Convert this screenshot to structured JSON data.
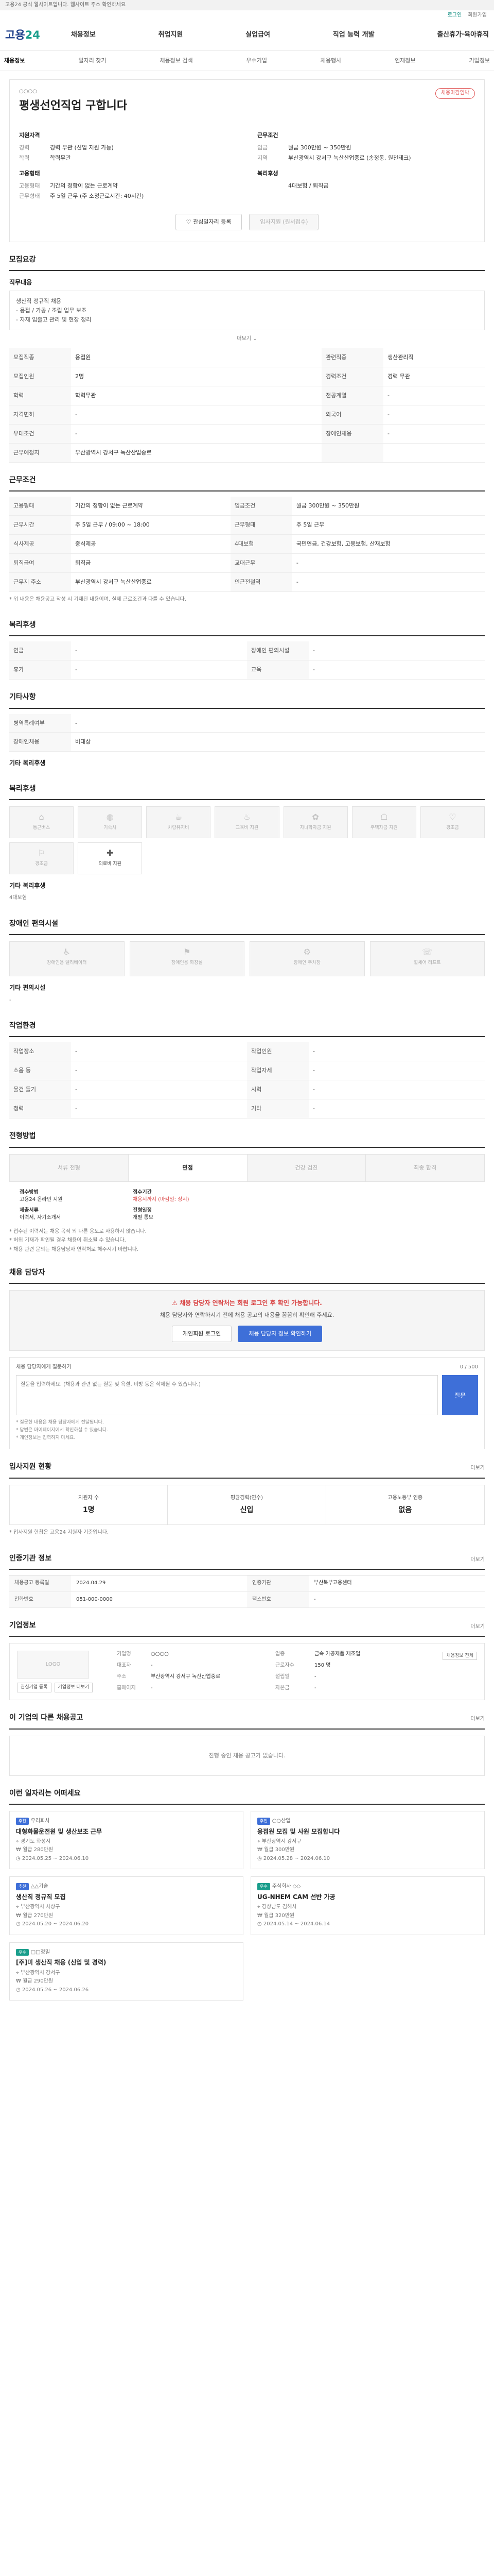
{
  "top_notice": "고용24 공식 웹사이트입니다. 웹사이트 주소 확인하세요",
  "util": {
    "login": "로그인",
    "signup": "회원가입"
  },
  "logo": {
    "part1": "고용",
    "part2": "24"
  },
  "gnb": [
    "채용정보",
    "취업지원",
    "실업급여",
    "직업 능력 개발",
    "출산휴가·육아휴직"
  ],
  "crumbs": [
    "채용정보",
    "일자리 찾기",
    "채용정보 검색",
    "우수기업",
    "채용행사",
    "인재정보",
    "기업정보"
  ],
  "job": {
    "company": "○○○○",
    "title": "평생선언직업 구합니다",
    "badge": "채용마감임박",
    "left_title": "지원자격",
    "left_rows": [
      {
        "k": "경력",
        "v": "경력 무관 (신입 지원 가능)"
      },
      {
        "k": "학력",
        "v": "학력무관"
      }
    ],
    "right_title": "근무조건",
    "right_rows": [
      {
        "k": "임금",
        "v": "월급 300만원 ~ 350만원"
      },
      {
        "k": "지역",
        "v": "부산광역시 강서구 녹산산업중로 (송정동, 원천테크)"
      }
    ],
    "left2_title": "고용형태",
    "left2_rows": [
      {
        "k": "고용형태",
        "v": "기간의 정함이 없는 근로계약"
      },
      {
        "k": "근무형태",
        "v": "주 5일 근무 (주 소정근로시간: 40시간)"
      }
    ],
    "right2_title": "복리후생",
    "right2_rows": [
      {
        "k": "",
        "v": "4대보험 / 퇴직금"
      }
    ],
    "btn_save": "관심일자리 등록",
    "btn_apply": "입사지원 (원서접수)"
  },
  "recruit": {
    "title": "모집요강",
    "sub": "직무내용",
    "box": [
      "생산직 정규직 채용",
      "- 용접 / 가공 / 조립 업무 보조",
      "- 자재 입출고 관리 및 현장 정리"
    ],
    "fold": "더보기",
    "rows": [
      [
        "모집직종",
        "용접원",
        "관련직종",
        "생산관리직"
      ],
      [
        "모집인원",
        "2명",
        "경력조건",
        "경력 무관"
      ],
      [
        "학력",
        "학력무관",
        "전공계열",
        "-"
      ],
      [
        "자격면허",
        "-",
        "외국어",
        "-"
      ],
      [
        "우대조건",
        "-",
        "장애인채용",
        "-"
      ],
      [
        "근무예정지",
        "부산광역시 강서구 녹산산업중로",
        "",
        ""
      ]
    ]
  },
  "condition": {
    "title": "근무조건",
    "rows": [
      [
        "고용형태",
        "기간의 정함이 없는 근로계약",
        "임금조건",
        "월급 300만원 ~ 350만원"
      ],
      [
        "근무시간",
        "주 5일 근무 / 09:00 ~ 18:00",
        "근무형태",
        "주 5일 근무"
      ],
      [
        "식사제공",
        "중식제공",
        "4대보험",
        "국민연금, 건강보험, 고용보험, 산재보험"
      ],
      [
        "퇴직급여",
        "퇴직금",
        "교대근무",
        "-"
      ],
      [
        "근무지 주소",
        "부산광역시 강서구 녹산산업중로",
        "인근전철역",
        "-"
      ]
    ],
    "note": "* 위 내용은 채용공고 작성 시 기재된 내용이며, 실제 근로조건과 다를 수 있습니다."
  },
  "welfare": {
    "title": "복리후생",
    "rows": [
      [
        "연금",
        "-",
        "장애인 편의시설",
        "-"
      ],
      [
        "휴가",
        "-",
        "교육",
        "-"
      ]
    ]
  },
  "etc": {
    "title": "기타사항",
    "rows": [
      [
        "병역특례여부",
        "-"
      ],
      [
        "장애인채용",
        "비대상"
      ]
    ],
    "sub": "기타 복리후생"
  },
  "welfare_icons": {
    "title": "복리후생",
    "items": [
      {
        "icon": "⌂",
        "label": "통근버스",
        "on": false
      },
      {
        "icon": "◍",
        "label": "기숙사",
        "on": false
      },
      {
        "icon": "☕",
        "label": "차량유지비",
        "on": false
      },
      {
        "icon": "♨",
        "label": "교육비 지원",
        "on": false
      },
      {
        "icon": "✿",
        "label": "자녀학자금 지원",
        "on": false
      },
      {
        "icon": "☖",
        "label": "주택자금 지원",
        "on": false
      },
      {
        "icon": "♡",
        "label": "경조금",
        "on": false
      },
      {
        "icon": "⚐",
        "label": "경조금",
        "on": false
      },
      {
        "icon": "✚",
        "label": "의료비 지원",
        "on": true
      }
    ],
    "etc_label": "기타 복리후생",
    "etc_value": "4대보험"
  },
  "disabled": {
    "title": "장애인 편의시설",
    "items": [
      {
        "icon": "♿",
        "label": "장애인용 엘리베이터"
      },
      {
        "icon": "⚑",
        "label": "장애인용 화장실"
      },
      {
        "icon": "⚙",
        "label": "장애인 주차장"
      },
      {
        "icon": "☏",
        "label": "휠체어 리프트"
      }
    ],
    "sub": "기타 편의시설",
    "value": "-"
  },
  "env": {
    "title": "작업환경",
    "rows": [
      [
        "작업장소",
        "-",
        "작업인원",
        "-"
      ],
      [
        "소음 등",
        "-",
        "작업자세",
        "-"
      ],
      [
        "물건 들기",
        "-",
        "시력",
        "-"
      ],
      [
        "청력",
        "-",
        "기타",
        "-"
      ]
    ]
  },
  "process": {
    "title": "전형방법",
    "steps": [
      "서류 전형",
      "면접",
      "건강 검진",
      "최종 합격"
    ],
    "active": 1,
    "info": [
      {
        "k": "접수방법",
        "v": "고용24 온라인 지원",
        "red": false
      },
      {
        "k": "접수기간",
        "v": "채용시까지 (마감일: 상시)",
        "red": true
      },
      {
        "k": "제출서류",
        "v": "이력서, 자기소개서",
        "red": false
      },
      {
        "k": "전형일정",
        "v": "개별 통보",
        "red": false
      }
    ],
    "notes": [
      "* 접수된 이력서는 채용 목적 외 다른 용도로 사용하지 않습니다.",
      "* 허위 기재가 확인될 경우 채용이 취소될 수 있습니다.",
      "* 채용 관련 문의는 채용담당자 연락처로 해주시기 바랍니다."
    ]
  },
  "contact": {
    "title": "채용 담당자",
    "warn": "채용 담당자 연락처는 회원 로그인 후 확인 가능합니다.",
    "desc": "채용 담당자와 연락하시기 전에 채용 공고의 내용을 꼼꼼히 확인해 주세요.",
    "btn1": "개인회원 로그인",
    "btn2": "채용 담당자 정보 확인하기"
  },
  "inquiry": {
    "title": "채용 담당자에게 질문하기",
    "count": "0 / 500",
    "placeholder": "질문을 입력하세요. (채용과 관련 없는 질문 및 욕설, 비방 등은 삭제될 수 있습니다.)",
    "btn": "질문",
    "notes": [
      "* 질문한 내용은 채용 담당자에게 전달됩니다.",
      "* 답변은 마이페이지에서 확인하실 수 있습니다.",
      "* 개인정보는 입력하지 마세요."
    ]
  },
  "stats": {
    "title": "입사지원 현황",
    "more": "더보기",
    "items": [
      {
        "label": "지원자 수",
        "value": "1명"
      },
      {
        "label": "평균경력(연수)",
        "value": "신입"
      },
      {
        "label": "고용노동부 인증",
        "value": "없음"
      }
    ],
    "note": "* 입사지원 현황은 고용24 지원자 기준입니다."
  },
  "agency": {
    "title": "인증기관 정보",
    "more": "더보기",
    "rows": [
      [
        "채용공고 등록일",
        "2024.04.29",
        "인증기관",
        "부산북부고용센터"
      ],
      [
        "전화번호",
        "051-000-0000",
        "팩스번호",
        "-"
      ]
    ]
  },
  "corp": {
    "title": "기업정보",
    "more": "더보기",
    "logo": "LOGO",
    "btn1": "관심기업 등록",
    "btn2": "기업정보 더보기",
    "side": "채용정보 전체",
    "rows": [
      [
        "기업명",
        "○○○○",
        "업종",
        "금속 가공제품 제조업"
      ],
      [
        "대표자",
        "-",
        "근로자수",
        "150 명"
      ],
      [
        "주소",
        "부산광역시 강서구 녹산산업중로",
        "설립일",
        "-"
      ],
      [
        "홈페이지",
        "-",
        "자본금",
        "-"
      ]
    ]
  },
  "other": {
    "title": "이 기업의 다른 채용공고",
    "more": "더보기",
    "empty": "진행 중인 채용 공고가 없습니다."
  },
  "recommend": {
    "title": "이런 일자리는 어떠세요",
    "items": [
      {
        "tag": "추천",
        "green": false,
        "company": "우리회사",
        "title": "대형화물운전원 및 생산보조 근무",
        "meta1": "경기도 화성시",
        "meta2": "월급 280만원",
        "meta3": "2024.05.25 ~ 2024.06.10"
      },
      {
        "tag": "추천",
        "green": false,
        "company": "○○산업",
        "title": "용접원 모집 및 사원 모집합니다",
        "meta1": "부산광역시 강서구",
        "meta2": "월급 300만원",
        "meta3": "2024.05.28 ~ 2024.06.10"
      },
      {
        "tag": "추천",
        "green": false,
        "company": "△△기술",
        "title": "생산직 정규직 모집",
        "meta1": "부산광역시 사상구",
        "meta2": "월급 270만원",
        "meta3": "2024.05.20 ~ 2024.06.20"
      },
      {
        "tag": "우수",
        "green": true,
        "company": "주식회사 ◇◇",
        "title": "UG-NHEM CAM 선반 가공",
        "meta1": "경상남도 김해시",
        "meta2": "월급 320만원",
        "meta3": "2024.05.14 ~ 2024.06.14"
      },
      {
        "tag": "우수",
        "green": true,
        "company": "□□정밀",
        "title": "[주]미 생산직 채용 (신입 및 경력)",
        "meta1": "부산광역시 강서구",
        "meta2": "월급 290만원",
        "meta3": "2024.05.26 ~ 2024.06.26"
      }
    ]
  }
}
